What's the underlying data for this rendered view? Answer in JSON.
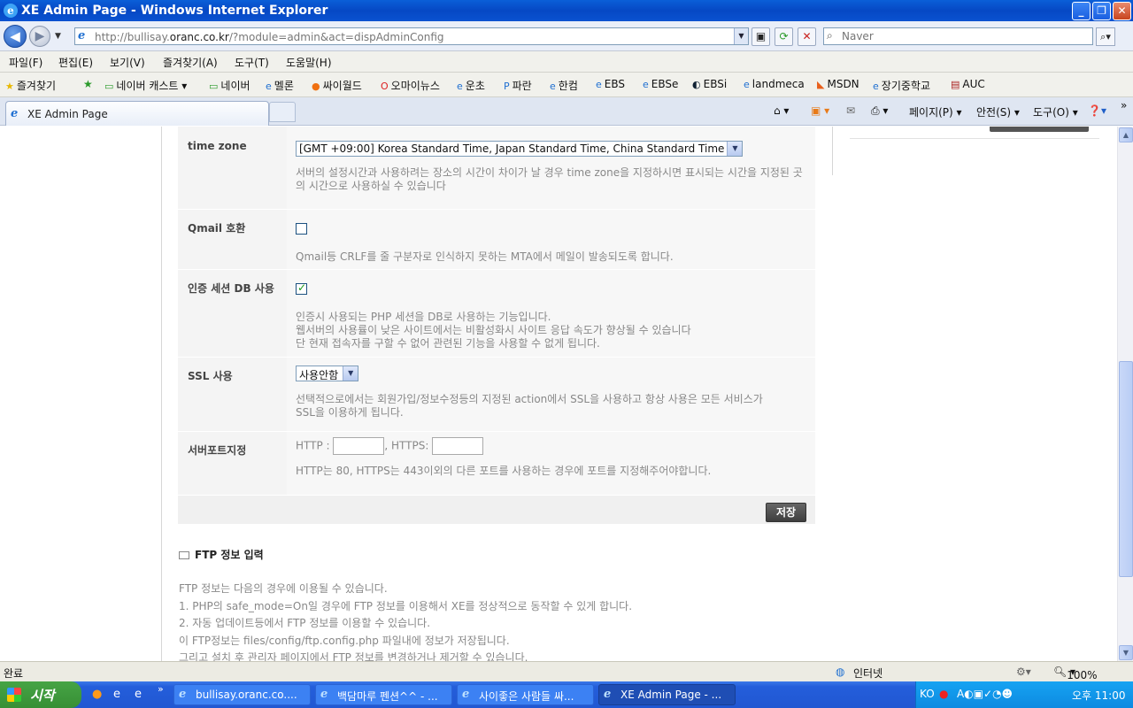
{
  "window": {
    "title": "XE Admin Page - Windows Internet Explorer"
  },
  "address": {
    "url_prefix": "http://bullisay.",
    "url_domain": "oranc.co.kr",
    "url_suffix": "/?module=admin&act=dispAdminConfig"
  },
  "search": {
    "placeholder": "Naver"
  },
  "menu": [
    "파일(F)",
    "편집(E)",
    "보기(V)",
    "즐겨찾기(A)",
    "도구(T)",
    "도움말(H)"
  ],
  "favorites": {
    "label": "즐겨찾기",
    "items": [
      "네이버 캐스트",
      "네이버",
      "멜론",
      "싸이월드",
      "오마이뉴스",
      "운초",
      "파란",
      "한컴",
      "EBS",
      "EBSe",
      "EBSi",
      "landmeca",
      "MSDN",
      "장기중학교",
      "AUC"
    ]
  },
  "tab": {
    "label": "XE Admin Page"
  },
  "commands": {
    "page": "페이지(P)",
    "safety": "안전(S)",
    "tools": "도구(O)"
  },
  "settings": {
    "timezone": {
      "label": "time zone",
      "value": "[GMT +09:00] Korea Standard Time, Japan Standard Time, China Standard Time",
      "desc": "서버의 설정시간과 사용하려는 장소의 시간이 차이가 날 경우 time zone을 지정하시면 표시되는 시간을 지정된 곳의 시간으로 사용하실 수 있습니다"
    },
    "qmail": {
      "label": "Qmail 호환",
      "checked": false,
      "desc": "Qmail등 CRLF를 줄 구분자로 인식하지 못하는 MTA에서 메일이 발송되도록 합니다."
    },
    "session": {
      "label": "인증 세션 DB 사용",
      "checked": true,
      "desc1": "인증시 사용되는 PHP 세션을 DB로 사용하는 기능입니다.",
      "desc2": "웹서버의 사용률이 낮은 사이트에서는 비활성화시 사이트 응답 속도가 향상될 수 있습니다",
      "desc3": "단 현재 접속자를 구할 수 없어 관련된 기능을 사용할 수 없게 됩니다."
    },
    "ssl": {
      "label": "SSL 사용",
      "value": "사용안함",
      "desc1": "선택적으로에서는 회원가입/정보수정등의 지정된 action에서 SSL을 사용하고 항상 사용은 모든 서비스가",
      "desc2": "SSL을 이용하게 됩니다."
    },
    "port": {
      "label": "서버포트지정",
      "http_label": "HTTP :",
      "https_label": ", HTTPS:",
      "desc": "HTTP는 80, HTTPS는 443이외의 다른 포트를 사용하는 경우에 포트를 지정해주어야합니다."
    },
    "save_label": "저장"
  },
  "ftp": {
    "title": "FTP 정보 입력",
    "lines": [
      "FTP 정보는 다음의 경우에 이용될 수 있습니다.",
      "1. PHP의 safe_mode=On일 경우에 FTP 정보를 이용해서 XE를 정상적으로 동작할 수 있게 합니다.",
      "2. 자동 업데이트등에서 FTP 정보를 이용할 수 있습니다.",
      "이 FTP정보는 files/config/ftp.config.php 파일내에 정보가 저장됩니다.",
      "그리고 설치 후 관리자 페이지에서 FTP 정보를 변경하거나 제거할 수 있습니다."
    ]
  },
  "status": {
    "left": "완료",
    "zone": "인터넷",
    "zoom": "100%"
  },
  "taskbar": {
    "start": "시작",
    "tasks": [
      "bullisay.oranc.co....",
      "백담마루 펜션^^ - ...",
      "사이좋은 사람들 싸...",
      "XE Admin Page - ..."
    ],
    "lang": "KO",
    "clock": "오후 11:00"
  }
}
